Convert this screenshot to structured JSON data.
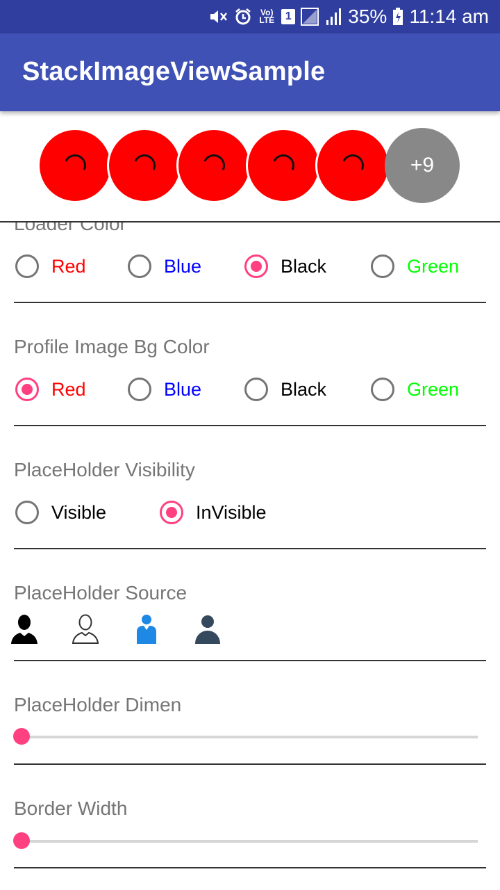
{
  "status_bar": {
    "battery": "35%",
    "time": "11:14 am",
    "sim_slot": "1",
    "network_label": "Vo) LTE"
  },
  "app": {
    "title": "StackImageViewSample"
  },
  "stack": {
    "more_label": "+9",
    "avatar_count": 5,
    "avatar_color": "#FF0000",
    "more_color": "#888888"
  },
  "loader_color": {
    "title": "Loader Color",
    "options": [
      {
        "label": "Red",
        "color": "#FF0000",
        "checked": false
      },
      {
        "label": "Blue",
        "color": "#0000FF",
        "checked": false
      },
      {
        "label": "Black",
        "color": "#000000",
        "checked": true
      },
      {
        "label": "Green",
        "color": "#00FF00",
        "checked": false
      }
    ]
  },
  "profile_bg": {
    "title": "Profile Image Bg Color",
    "options": [
      {
        "label": "Red",
        "color": "#FF0000",
        "checked": true
      },
      {
        "label": "Blue",
        "color": "#0000FF",
        "checked": false
      },
      {
        "label": "Black",
        "color": "#000000",
        "checked": false
      },
      {
        "label": "Green",
        "color": "#00FF00",
        "checked": false
      }
    ]
  },
  "placeholder_visibility": {
    "title": "PlaceHolder Visibility",
    "options": [
      {
        "label": "Visible",
        "checked": false
      },
      {
        "label": "InVisible",
        "checked": true
      }
    ]
  },
  "placeholder_source": {
    "title": "PlaceHolder Source",
    "icons": [
      "person-filled-black-icon",
      "person-outline-icon",
      "person-blue-icon",
      "person-darkblue-icon"
    ]
  },
  "placeholder_dimen": {
    "title": "PlaceHolder Dimen",
    "value": 0
  },
  "border_width": {
    "title": "Border Width",
    "value": 0
  },
  "accent_color": "#FF4081",
  "primary_color": "#3F51B5",
  "primary_dark_color": "#303F9F"
}
